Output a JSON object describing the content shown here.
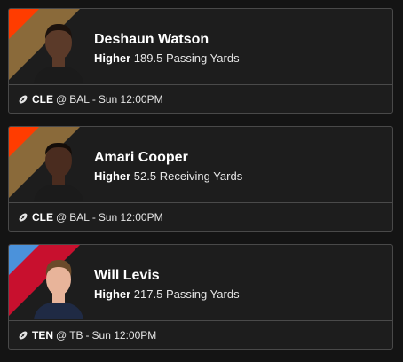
{
  "picks": [
    {
      "player": "Deshaun Watson",
      "direction": "Higher",
      "line": "189.5",
      "stat": "Passing Yards",
      "team": "CLE",
      "at": "@",
      "opponent": "BAL",
      "separator": "-",
      "time": "Sun 12:00PM",
      "accent_primary": "#ff3c00",
      "accent_secondary": "#8a6a3a",
      "avatar_skin": "#5b3a29",
      "avatar_hair": "#1c120d",
      "avatar_shirt": "#1b1b1b"
    },
    {
      "player": "Amari Cooper",
      "direction": "Higher",
      "line": "52.5",
      "stat": "Receiving Yards",
      "team": "CLE",
      "at": "@",
      "opponent": "BAL",
      "separator": "-",
      "time": "Sun 12:00PM",
      "accent_primary": "#ff3c00",
      "accent_secondary": "#8a6a3a",
      "avatar_skin": "#4a2c1f",
      "avatar_hair": "#140d09",
      "avatar_shirt": "#1b1b1b"
    },
    {
      "player": "Will Levis",
      "direction": "Higher",
      "line": "217.5",
      "stat": "Passing Yards",
      "team": "TEN",
      "at": "@",
      "opponent": "TB",
      "separator": "-",
      "time": "Sun 12:00PM",
      "accent_primary": "#4b92db",
      "accent_secondary": "#c8102e",
      "avatar_skin": "#e8b49a",
      "avatar_hair": "#6a4a2a",
      "avatar_shirt": "#1f2a44"
    }
  ],
  "icons": {
    "sport": "football-icon"
  }
}
